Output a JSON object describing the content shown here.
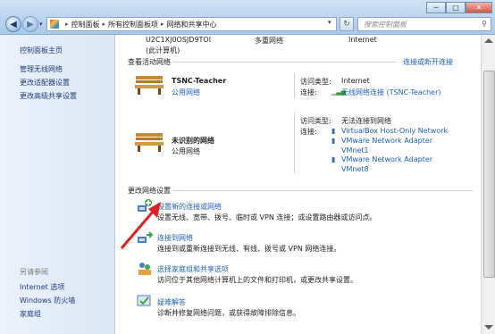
{
  "address": {
    "crumbs": [
      "控制面板",
      "所有控制面板项",
      "网络和共享中心"
    ],
    "search_placeholder": "搜索控制面板"
  },
  "sidebar": {
    "items": [
      "控制面板主页",
      "管理无线网络",
      "更改适配器设置",
      "更改高级共享设置"
    ],
    "see_also_heading": "另请参阅",
    "see_also": [
      "Internet 选项",
      "Windows 防火墙",
      "家庭组"
    ]
  },
  "top_partial": {
    "host": "U2C1XJ0OSJD9TOI",
    "host_sub": "(此计算机)",
    "multi": "多重网络",
    "internet": "Internet"
  },
  "active_networks": {
    "title": "查看活动网络",
    "connect_link": "连接或断开连接",
    "networks": [
      {
        "name": "TSNC-Teacher",
        "type": "公用网络",
        "access_label": "访问类型:",
        "access_value": "Internet",
        "conn_label": "连接:",
        "conn_value": "无线网络连接 (TSNC-Teacher)"
      },
      {
        "name": "未识别的网络",
        "type": "公用网络",
        "access_label": "访问类型:",
        "access_value": "无法连接到网络",
        "conn_label": "连接:",
        "conn_values": [
          "VirtualBox Host-Only Network",
          "VMware Network Adapter",
          "VMnet1",
          "VMware Network Adapter",
          "VMnet8"
        ]
      }
    ]
  },
  "change_settings": {
    "title": "更改网络设置",
    "tasks": [
      {
        "link": "设置新的连接或网络",
        "desc": "设置无线、宽带、拨号、临时或 VPN 连接；或设置路由器或访问点。"
      },
      {
        "link": "连接到网络",
        "desc": "连接到或重新连接到无线、有线、拨号或 VPN 网络连接。"
      },
      {
        "link": "选择家庭组和共享选项",
        "desc": "访问位于其他网络计算机上的文件和打印机，或更改共享设置。"
      },
      {
        "link": "疑难解答",
        "desc": "诊断并修复网络问题，或获得故障排除信息。"
      }
    ]
  },
  "colors": {
    "link": "#1f5fbf",
    "annotation_arrow": "#e02020"
  }
}
